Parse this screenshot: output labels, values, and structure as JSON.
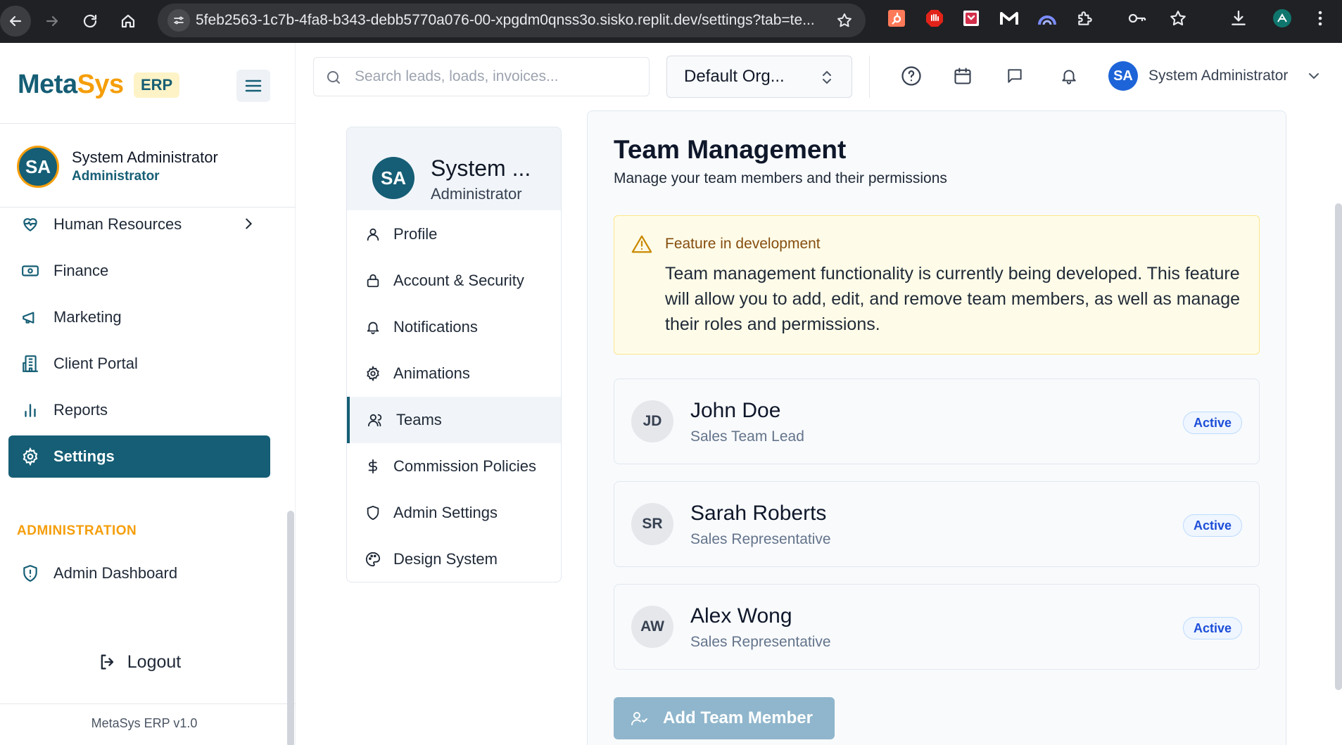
{
  "browser": {
    "url": "5feb2563-1c7b-4fa8-b343-debb5770a076-00-xpgdm0qnss3o.sisko.replit.dev/settings?tab=te..."
  },
  "brand": {
    "name_part1": "Meta",
    "name_part2": "Sys",
    "badge": "ERP",
    "color_primary": "#155e75",
    "color_accent": "#f59e0b"
  },
  "sidebar": {
    "user_initials": "SA",
    "user_name": "System Administrator",
    "user_role": "Administrator",
    "items": [
      {
        "label": "Human Resources",
        "icon": "heart-pulse-icon",
        "has_chevron": true
      },
      {
        "label": "Finance",
        "icon": "banknote-icon"
      },
      {
        "label": "Marketing",
        "icon": "megaphone-icon"
      },
      {
        "label": "Client Portal",
        "icon": "building-icon"
      },
      {
        "label": "Reports",
        "icon": "bar-chart-icon"
      },
      {
        "label": "Settings",
        "icon": "gear-icon",
        "active": true
      }
    ],
    "admin_heading": "ADMINISTRATION",
    "admin_items": [
      {
        "label": "Admin Dashboard",
        "icon": "shield-alert-icon"
      }
    ],
    "logout_label": "Logout",
    "version": "MetaSys ERP v1.0"
  },
  "topbar": {
    "search_placeholder": "Search leads, loads, invoices...",
    "org_selected": "Default Org...",
    "icons": [
      "help-icon",
      "calendar-icon",
      "message-icon",
      "bell-icon"
    ],
    "user_initials": "SA",
    "user_name": "System Administrator"
  },
  "settings_nav": {
    "user_initials": "SA",
    "user_name": "System ...",
    "user_role": "Administrator",
    "items": [
      {
        "label": "Profile",
        "icon": "user-icon"
      },
      {
        "label": "Account & Security",
        "icon": "lock-icon"
      },
      {
        "label": "Notifications",
        "icon": "bell-icon"
      },
      {
        "label": "Animations",
        "icon": "gear-icon"
      },
      {
        "label": "Teams",
        "icon": "users-icon",
        "active": true
      },
      {
        "label": "Commission Policies",
        "icon": "dollar-icon"
      },
      {
        "label": "Admin Settings",
        "icon": "shield-icon"
      },
      {
        "label": "Design System",
        "icon": "palette-icon"
      }
    ]
  },
  "panel": {
    "title": "Team Management",
    "subtitle": "Manage your team members and their permissions",
    "alert": {
      "title": "Feature in development",
      "body": "Team management functionality is currently being developed. This feature will allow you to add, edit, and remove team members, as well as manage their roles and permissions."
    },
    "members": [
      {
        "initials": "JD",
        "name": "John Doe",
        "role": "Sales Team Lead",
        "status": "Active"
      },
      {
        "initials": "SR",
        "name": "Sarah Roberts",
        "role": "Sales Representative",
        "status": "Active"
      },
      {
        "initials": "AW",
        "name": "Alex Wong",
        "role": "Sales Representative",
        "status": "Active"
      }
    ],
    "add_button": "Add Team Member"
  }
}
